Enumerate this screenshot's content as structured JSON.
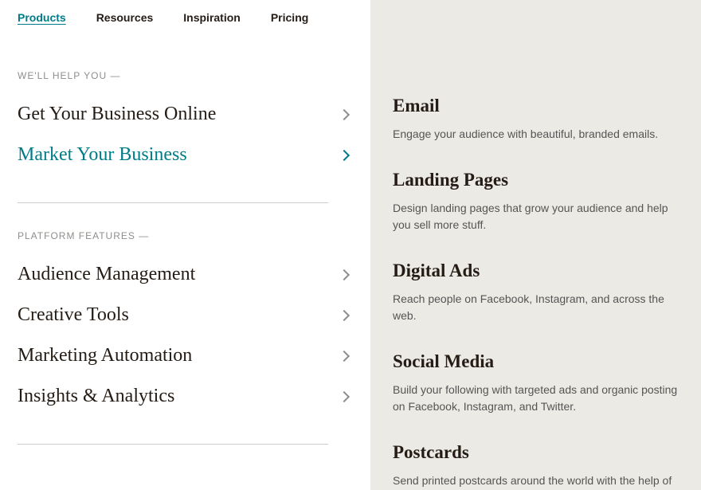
{
  "nav": {
    "items": [
      {
        "label": "Products",
        "active": true
      },
      {
        "label": "Resources",
        "active": false
      },
      {
        "label": "Inspiration",
        "active": false
      },
      {
        "label": "Pricing",
        "active": false
      }
    ]
  },
  "left": {
    "section1_label": "WE'LL HELP YOU —",
    "menu1": [
      {
        "label": "Get Your Business Online",
        "selected": false
      },
      {
        "label": "Market Your Business",
        "selected": true
      }
    ],
    "section2_label": "PLATFORM FEATURES —",
    "menu2": [
      {
        "label": "Audience Management",
        "selected": false
      },
      {
        "label": "Creative Tools",
        "selected": false
      },
      {
        "label": "Marketing Automation",
        "selected": false
      },
      {
        "label": "Insights & Analytics",
        "selected": false
      }
    ]
  },
  "right": {
    "features": [
      {
        "title": "Email",
        "desc": "Engage your audience with beautiful, branded emails."
      },
      {
        "title": "Landing Pages",
        "desc": "Design landing pages that grow your audience and help you sell more stuff."
      },
      {
        "title": "Digital Ads",
        "desc": "Reach people on Facebook, Instagram, and across the web."
      },
      {
        "title": "Social Media",
        "desc": "Build your following with targeted ads and organic posting on Facebook, Instagram, and Twitter."
      },
      {
        "title": "Postcards",
        "desc": "Send printed postcards around the world with the help of"
      }
    ]
  }
}
